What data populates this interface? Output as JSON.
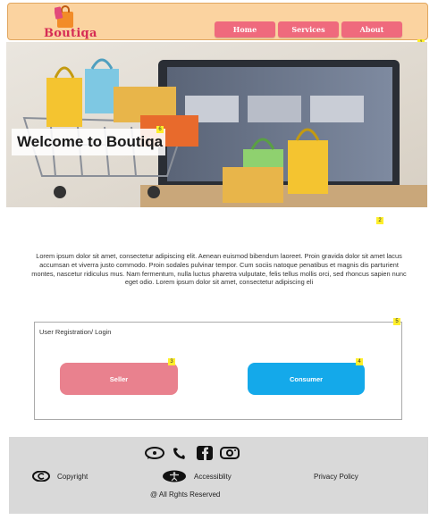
{
  "brand": {
    "logo_text": "Boutiqa"
  },
  "nav": {
    "items": [
      {
        "label": "Home"
      },
      {
        "label": "Services"
      },
      {
        "label": "About"
      }
    ]
  },
  "markers": [
    "1",
    "2",
    "3",
    "4",
    "5",
    "6"
  ],
  "hero": {
    "title": "Welcome to Boutiqa"
  },
  "intro": {
    "text": "Lorem ipsum dolor sit amet, consectetur adipiscing elit. Aenean euismod bibendum laoreet. Proin gravida dolor sit amet lacus accumsan et viverra justo commodo. Proin sodales pulvinar tempor. Cum sociis natoque penatibus et magnis dis parturient montes, nascetur ridiculus mus. Nam fermentum, nulla luctus pharetra vulputate, felis tellus mollis orci, sed rhoncus sapien nunc eget odio. Lorem ipsum dolor sit amet, consectetur adipiscing eli"
  },
  "registration": {
    "title": "User Registration/ Login",
    "seller_label": "Seller",
    "consumer_label": "Consumer"
  },
  "footer": {
    "socials": [
      "whatsapp-icon",
      "phone-icon",
      "facebook-icon",
      "instagram-icon"
    ],
    "copyright_label": "Copyright",
    "accessibility_label": "Accessiblity",
    "privacy_label": "Privacy Policy",
    "rights_text": "@ All Rghts Reserved"
  },
  "colors": {
    "header_bg": "#fbd3a0",
    "nav_button": "#ef6a7d",
    "seller": "#e9818e",
    "consumer": "#14a9ea",
    "footer_bg": "#d9d9d9",
    "brand_text": "#d62b55"
  }
}
